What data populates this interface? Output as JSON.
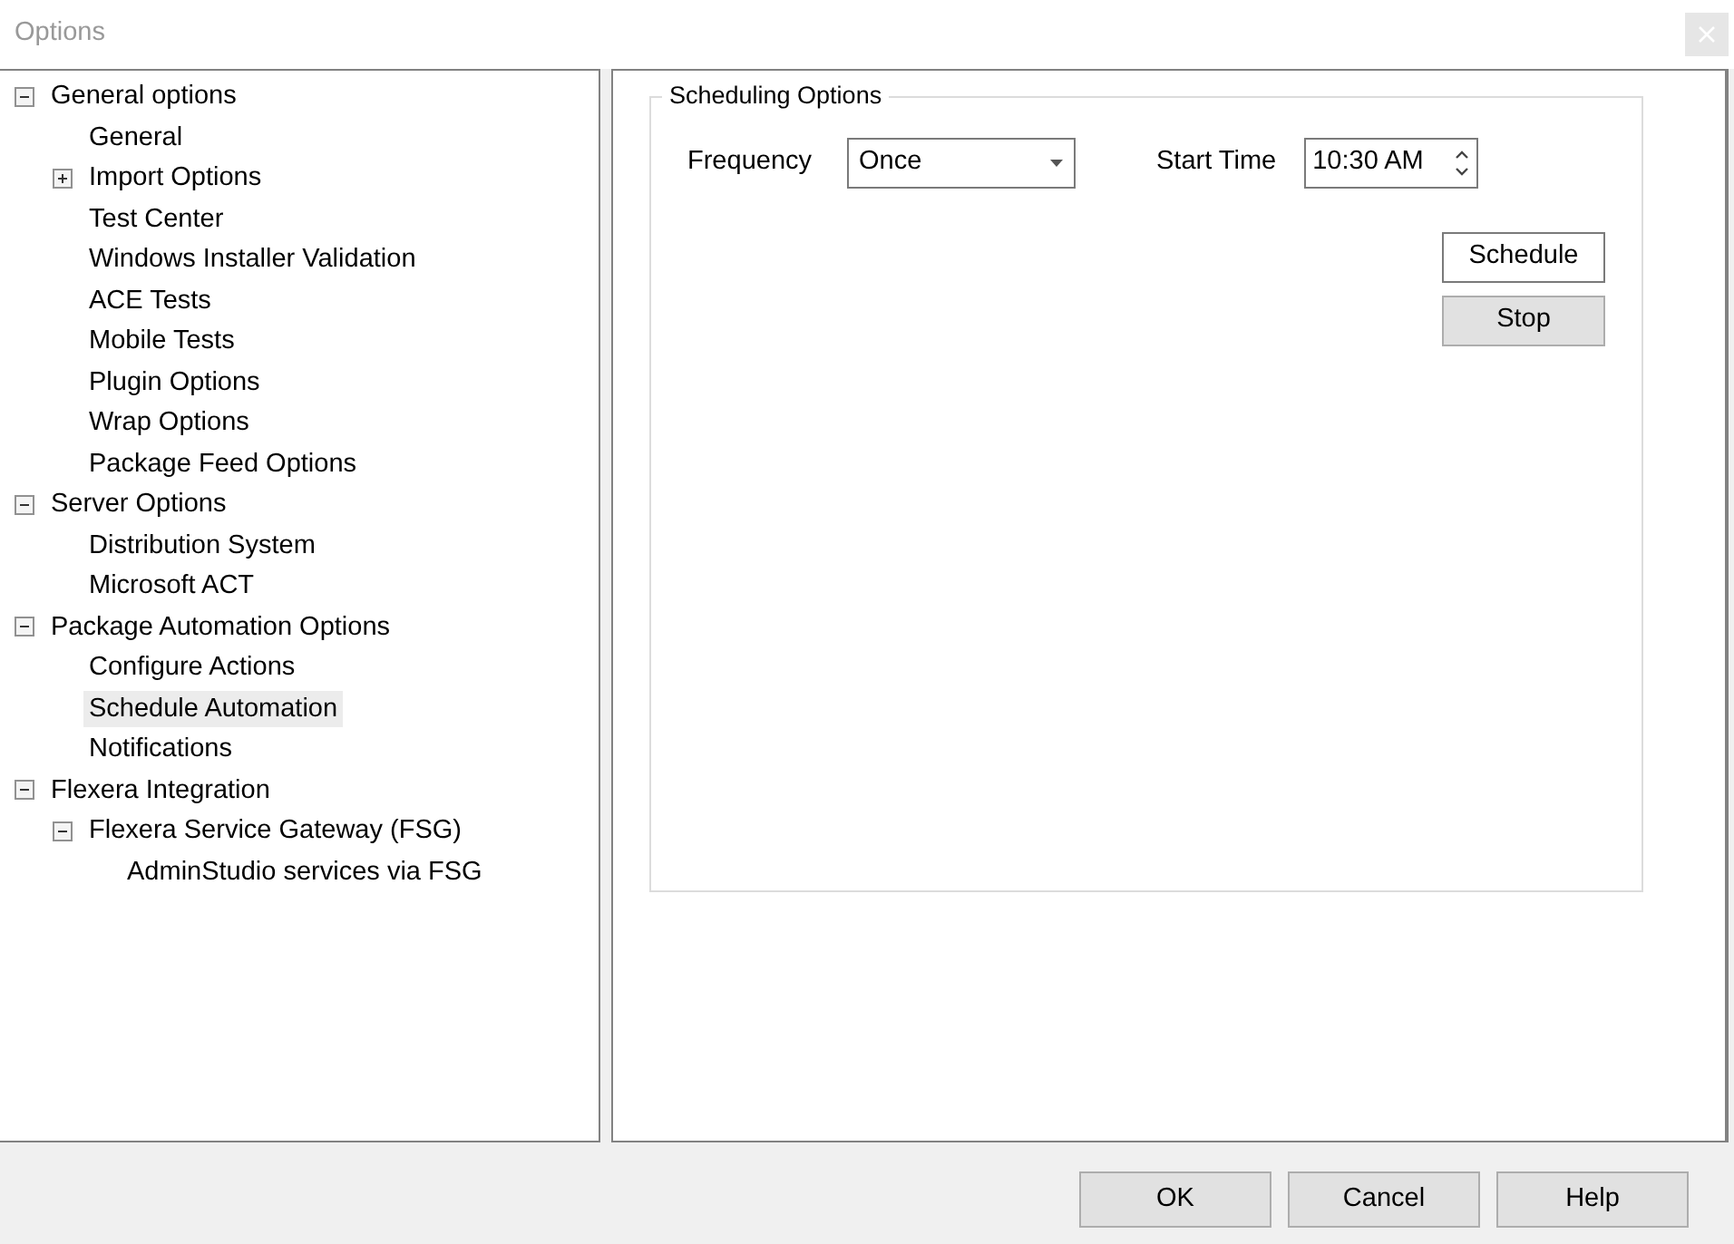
{
  "window": {
    "title": "Options"
  },
  "tree": [
    {
      "label": "General options",
      "expanded": true,
      "selected": false,
      "children": [
        {
          "label": "General",
          "selected": false
        },
        {
          "label": "Import Options",
          "expanded": false,
          "selected": false
        },
        {
          "label": "Test Center",
          "selected": false
        },
        {
          "label": "Windows Installer Validation",
          "selected": false
        },
        {
          "label": "ACE Tests",
          "selected": false
        },
        {
          "label": "Mobile Tests",
          "selected": false
        },
        {
          "label": "Plugin Options",
          "selected": false
        },
        {
          "label": "Wrap Options",
          "selected": false
        },
        {
          "label": "Package Feed Options",
          "selected": false
        }
      ]
    },
    {
      "label": "Server Options",
      "expanded": true,
      "selected": false,
      "children": [
        {
          "label": "Distribution System",
          "selected": false
        },
        {
          "label": "Microsoft ACT",
          "selected": false
        }
      ]
    },
    {
      "label": "Package Automation Options",
      "expanded": true,
      "selected": false,
      "children": [
        {
          "label": "Configure Actions",
          "selected": false
        },
        {
          "label": "Schedule Automation",
          "selected": true
        },
        {
          "label": "Notifications",
          "selected": false
        }
      ]
    },
    {
      "label": "Flexera Integration",
      "expanded": true,
      "selected": false,
      "children": [
        {
          "label": "Flexera Service Gateway (FSG)",
          "expanded": true,
          "selected": false,
          "children": [
            {
              "label": "AdminStudio services via FSG",
              "selected": false
            }
          ]
        }
      ]
    }
  ],
  "group": {
    "title": "Scheduling Options",
    "frequency_label": "Frequency",
    "frequency_value": "Once",
    "start_time_label": "Start Time",
    "start_time_value": "10:30 AM",
    "buttons": [
      {
        "label": "Schedule",
        "default": true
      },
      {
        "label": "Stop",
        "default": false
      }
    ]
  },
  "footer_buttons": [
    "OK",
    "Cancel",
    "Help"
  ]
}
